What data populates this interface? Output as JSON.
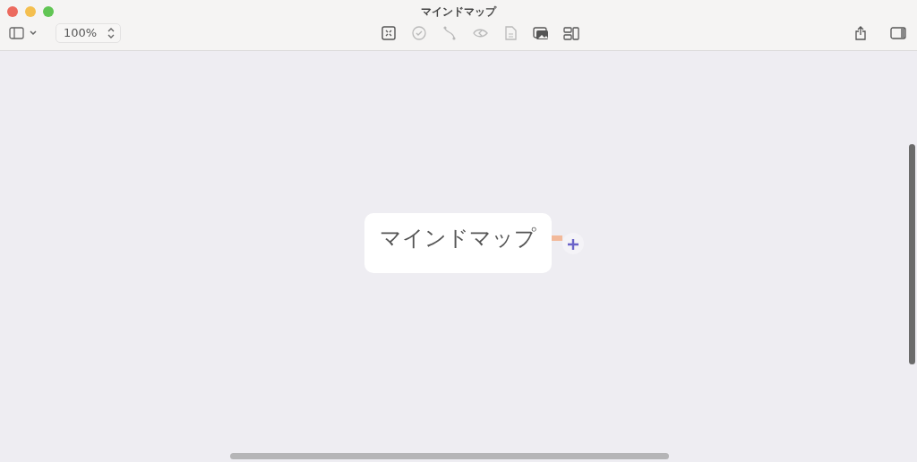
{
  "window": {
    "title": "マインドマップ"
  },
  "toolbar": {
    "zoom": "100%",
    "tools": [
      {
        "kind": "fit",
        "disabled": false
      },
      {
        "kind": "check",
        "disabled": true
      },
      {
        "kind": "connector",
        "disabled": true
      },
      {
        "kind": "back",
        "disabled": true
      },
      {
        "kind": "note",
        "disabled": true
      },
      {
        "kind": "image",
        "disabled": false
      },
      {
        "kind": "layout",
        "disabled": false
      }
    ]
  },
  "canvas": {
    "root_node": {
      "label": "マインドマップ"
    }
  }
}
